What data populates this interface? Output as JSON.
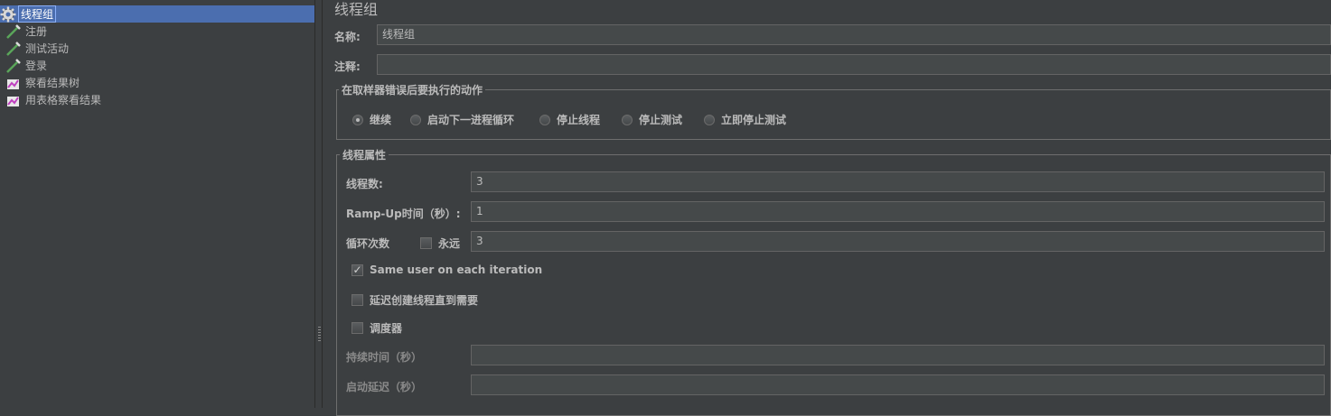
{
  "tree": {
    "items": [
      {
        "label": "线程组",
        "icon": "gear-icon",
        "selected": true
      },
      {
        "label": "注册",
        "icon": "pipette-icon"
      },
      {
        "label": "测试活动",
        "icon": "pipette-icon"
      },
      {
        "label": "登录",
        "icon": "pipette-icon"
      },
      {
        "label": "察看结果树",
        "icon": "graph-icon"
      },
      {
        "label": "用表格察看结果",
        "icon": "graph-icon"
      }
    ]
  },
  "panel": {
    "title": "线程组",
    "name_label": "名称:",
    "name_value": "线程组",
    "comment_label": "注释:",
    "comment_value": "",
    "error_group": {
      "legend": "在取样器错误后要执行的动作",
      "options": [
        "继续",
        "启动下一进程循环",
        "停止线程",
        "停止测试",
        "立即停止测试"
      ],
      "selected": "继续"
    },
    "props_group": {
      "legend": "线程属性",
      "threads_label": "线程数:",
      "threads_value": "3",
      "rampup_label": "Ramp-Up时间（秒）:",
      "rampup_value": "1",
      "loop_label": "循环次数",
      "forever_label": "永远",
      "forever_checked": false,
      "loop_value": "3",
      "same_user_label": "Same user on each iteration",
      "same_user_checked": true,
      "delay_label": "延迟创建线程直到需要",
      "delay_checked": false,
      "scheduler_label": "调度器",
      "scheduler_checked": false,
      "duration_label": "持续时间（秒）",
      "duration_value": "",
      "startup_delay_label": "启动延迟（秒）",
      "startup_delay_value": ""
    }
  },
  "colors": {
    "background": "#3c3f41",
    "selection": "#4b6eaf",
    "field": "#45494a",
    "text": "#bbbbbb"
  }
}
